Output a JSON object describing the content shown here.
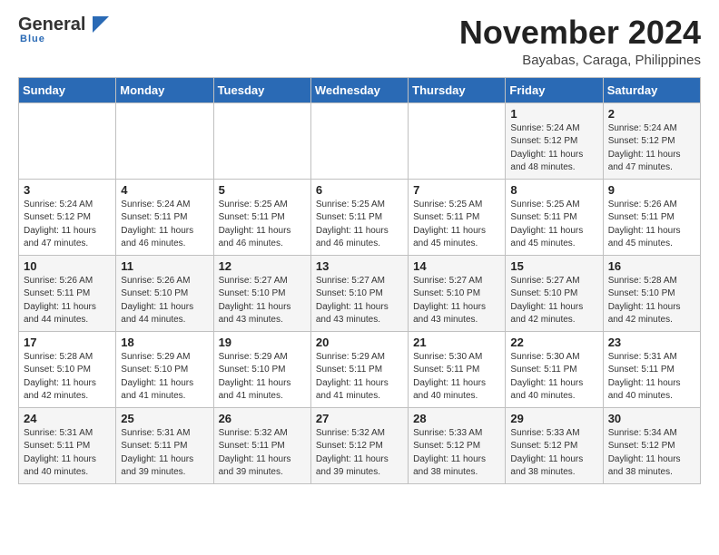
{
  "header": {
    "logo_line1": "General",
    "logo_line2": "Blue",
    "month": "November 2024",
    "location": "Bayabas, Caraga, Philippines"
  },
  "weekdays": [
    "Sunday",
    "Monday",
    "Tuesday",
    "Wednesday",
    "Thursday",
    "Friday",
    "Saturday"
  ],
  "weeks": [
    [
      {
        "day": "",
        "info": ""
      },
      {
        "day": "",
        "info": ""
      },
      {
        "day": "",
        "info": ""
      },
      {
        "day": "",
        "info": ""
      },
      {
        "day": "",
        "info": ""
      },
      {
        "day": "1",
        "info": "Sunrise: 5:24 AM\nSunset: 5:12 PM\nDaylight: 11 hours\nand 48 minutes."
      },
      {
        "day": "2",
        "info": "Sunrise: 5:24 AM\nSunset: 5:12 PM\nDaylight: 11 hours\nand 47 minutes."
      }
    ],
    [
      {
        "day": "3",
        "info": "Sunrise: 5:24 AM\nSunset: 5:12 PM\nDaylight: 11 hours\nand 47 minutes."
      },
      {
        "day": "4",
        "info": "Sunrise: 5:24 AM\nSunset: 5:11 PM\nDaylight: 11 hours\nand 46 minutes."
      },
      {
        "day": "5",
        "info": "Sunrise: 5:25 AM\nSunset: 5:11 PM\nDaylight: 11 hours\nand 46 minutes."
      },
      {
        "day": "6",
        "info": "Sunrise: 5:25 AM\nSunset: 5:11 PM\nDaylight: 11 hours\nand 46 minutes."
      },
      {
        "day": "7",
        "info": "Sunrise: 5:25 AM\nSunset: 5:11 PM\nDaylight: 11 hours\nand 45 minutes."
      },
      {
        "day": "8",
        "info": "Sunrise: 5:25 AM\nSunset: 5:11 PM\nDaylight: 11 hours\nand 45 minutes."
      },
      {
        "day": "9",
        "info": "Sunrise: 5:26 AM\nSunset: 5:11 PM\nDaylight: 11 hours\nand 45 minutes."
      }
    ],
    [
      {
        "day": "10",
        "info": "Sunrise: 5:26 AM\nSunset: 5:11 PM\nDaylight: 11 hours\nand 44 minutes."
      },
      {
        "day": "11",
        "info": "Sunrise: 5:26 AM\nSunset: 5:10 PM\nDaylight: 11 hours\nand 44 minutes."
      },
      {
        "day": "12",
        "info": "Sunrise: 5:27 AM\nSunset: 5:10 PM\nDaylight: 11 hours\nand 43 minutes."
      },
      {
        "day": "13",
        "info": "Sunrise: 5:27 AM\nSunset: 5:10 PM\nDaylight: 11 hours\nand 43 minutes."
      },
      {
        "day": "14",
        "info": "Sunrise: 5:27 AM\nSunset: 5:10 PM\nDaylight: 11 hours\nand 43 minutes."
      },
      {
        "day": "15",
        "info": "Sunrise: 5:27 AM\nSunset: 5:10 PM\nDaylight: 11 hours\nand 42 minutes."
      },
      {
        "day": "16",
        "info": "Sunrise: 5:28 AM\nSunset: 5:10 PM\nDaylight: 11 hours\nand 42 minutes."
      }
    ],
    [
      {
        "day": "17",
        "info": "Sunrise: 5:28 AM\nSunset: 5:10 PM\nDaylight: 11 hours\nand 42 minutes."
      },
      {
        "day": "18",
        "info": "Sunrise: 5:29 AM\nSunset: 5:10 PM\nDaylight: 11 hours\nand 41 minutes."
      },
      {
        "day": "19",
        "info": "Sunrise: 5:29 AM\nSunset: 5:10 PM\nDaylight: 11 hours\nand 41 minutes."
      },
      {
        "day": "20",
        "info": "Sunrise: 5:29 AM\nSunset: 5:11 PM\nDaylight: 11 hours\nand 41 minutes."
      },
      {
        "day": "21",
        "info": "Sunrise: 5:30 AM\nSunset: 5:11 PM\nDaylight: 11 hours\nand 40 minutes."
      },
      {
        "day": "22",
        "info": "Sunrise: 5:30 AM\nSunset: 5:11 PM\nDaylight: 11 hours\nand 40 minutes."
      },
      {
        "day": "23",
        "info": "Sunrise: 5:31 AM\nSunset: 5:11 PM\nDaylight: 11 hours\nand 40 minutes."
      }
    ],
    [
      {
        "day": "24",
        "info": "Sunrise: 5:31 AM\nSunset: 5:11 PM\nDaylight: 11 hours\nand 40 minutes."
      },
      {
        "day": "25",
        "info": "Sunrise: 5:31 AM\nSunset: 5:11 PM\nDaylight: 11 hours\nand 39 minutes."
      },
      {
        "day": "26",
        "info": "Sunrise: 5:32 AM\nSunset: 5:11 PM\nDaylight: 11 hours\nand 39 minutes."
      },
      {
        "day": "27",
        "info": "Sunrise: 5:32 AM\nSunset: 5:12 PM\nDaylight: 11 hours\nand 39 minutes."
      },
      {
        "day": "28",
        "info": "Sunrise: 5:33 AM\nSunset: 5:12 PM\nDaylight: 11 hours\nand 38 minutes."
      },
      {
        "day": "29",
        "info": "Sunrise: 5:33 AM\nSunset: 5:12 PM\nDaylight: 11 hours\nand 38 minutes."
      },
      {
        "day": "30",
        "info": "Sunrise: 5:34 AM\nSunset: 5:12 PM\nDaylight: 11 hours\nand 38 minutes."
      }
    ]
  ]
}
